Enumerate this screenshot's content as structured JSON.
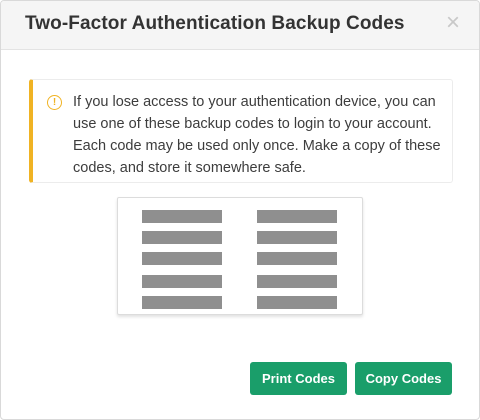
{
  "dialog": {
    "title": "Two-Factor Authentication Backup Codes",
    "close_label": "×"
  },
  "alert": {
    "icon": "warning-circle-icon",
    "icon_glyph": "!",
    "message": "If you lose access to your authentication device, you can use one of these backup codes to login to your account. Each code may be used only once. Make a copy of these codes, and store it somewhere safe.",
    "accent_color": "#f0b323"
  },
  "codes": {
    "left_column": [
      "redacted",
      "redacted",
      "redacted",
      "redacted",
      "redacted"
    ],
    "right_column": [
      "redacted",
      "redacted",
      "redacted",
      "redacted",
      "redacted"
    ]
  },
  "actions": {
    "print_label": "Print Codes",
    "copy_label": "Copy Codes",
    "button_color": "#1a9e6a"
  }
}
